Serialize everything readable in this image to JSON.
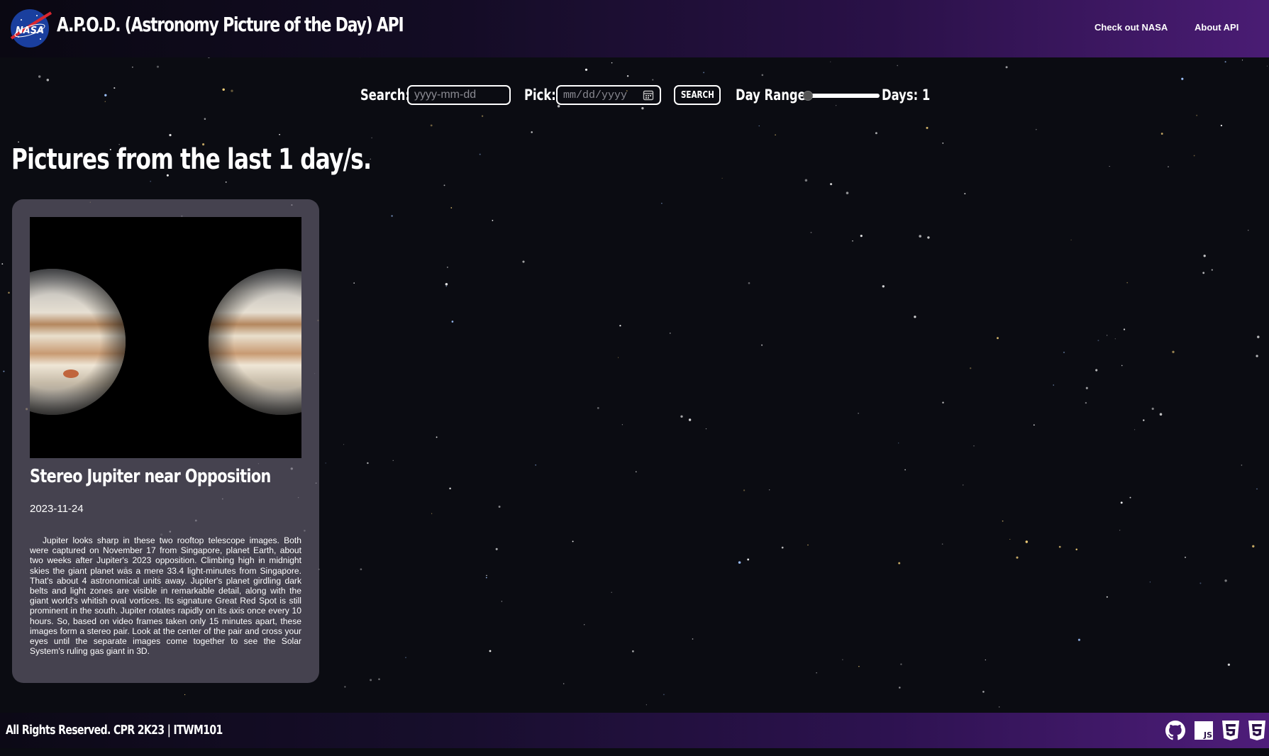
{
  "header": {
    "title": "A.P.O.D. (Astronomy Picture of the Day) API",
    "logo_text": "NASA",
    "nav": [
      "Check out NASA",
      "About API"
    ]
  },
  "search": {
    "search_label": "Search:",
    "search_placeholder": "yyyy-mm-dd",
    "pick_label": "Pick:",
    "pick_placeholder": "mm/dd/yyyy",
    "search_button": "SEARCH",
    "range_label": "Day Range:",
    "days_label": "Days: 1",
    "range_value": 1
  },
  "heading": "Pictures from the last 1 day/s.",
  "card": {
    "title": "Stereo Jupiter near Opposition",
    "date": "2023-11-24",
    "description": "Jupiter looks sharp in these two rooftop telescope images. Both were captured on November 17 from Singapore, planet Earth, about two weeks after Jupiter's 2023 opposition. Climbing high in midnight skies the giant planet was a mere 33.4 light-minutes from Singapore. That's about 4 astronomical units away. Jupiter's planet girdling dark belts and light zones are visible in remarkable detail, along with the giant world's whitish oval vortices. Its signature Great Red Spot is still prominent in the south. Jupiter rotates rapidly on its axis once every 10 hours. So, based on video frames taken only 15 minutes apart, these images form a stereo pair. Look at the center of the pair and cross your eyes until the separate images come together to see the Solar System's ruling gas giant in 3D."
  },
  "footer": {
    "text": "All Rights Reserved. CPR 2K23 | ITWM101",
    "icons": [
      "github-icon",
      "javascript-icon",
      "html5-icon",
      "css3-icon"
    ]
  },
  "colors": {
    "background": "#0b0c12",
    "header_accent": "#4a1c74",
    "card_bg": "#5c5866"
  }
}
